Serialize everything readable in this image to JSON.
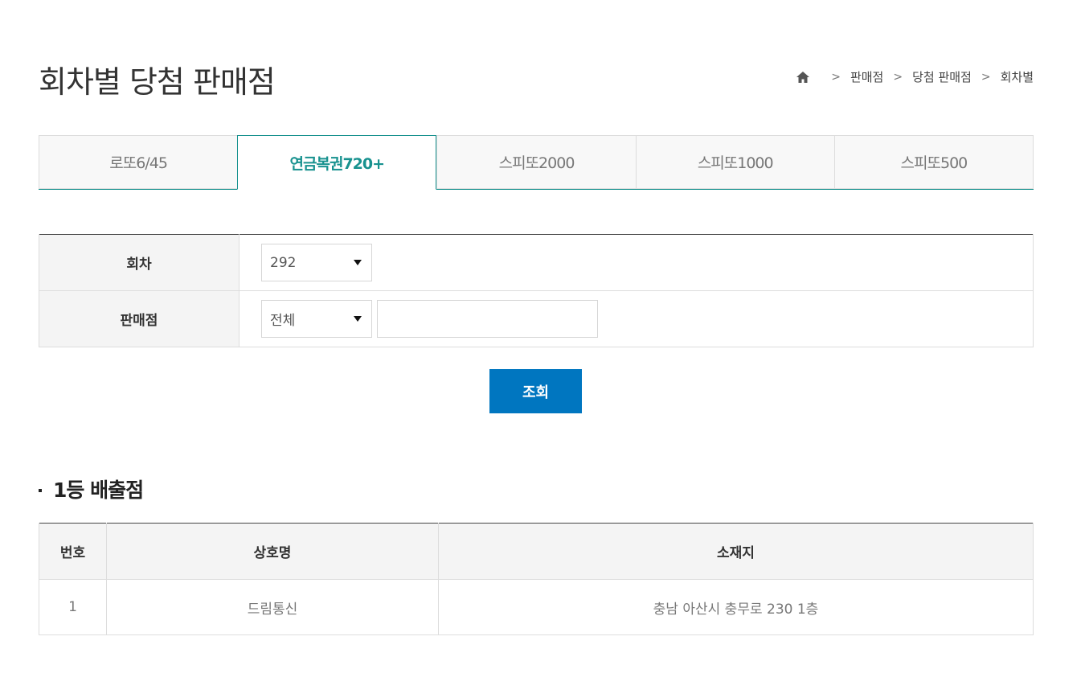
{
  "page": {
    "title": "회차별 당첨 판매점"
  },
  "breadcrumb": {
    "home_icon": "home-icon",
    "items": [
      "판매점",
      "당첨 판매점",
      "회차별"
    ]
  },
  "tabs": [
    {
      "label": "로또6/45",
      "active": false
    },
    {
      "label": "연금복권720+",
      "active": true
    },
    {
      "label": "스피또2000",
      "active": false
    },
    {
      "label": "스피또1000",
      "active": false
    },
    {
      "label": "스피또500",
      "active": false
    }
  ],
  "search": {
    "round_label": "회차",
    "round_value": "292",
    "store_label": "판매점",
    "store_filter_value": "전체",
    "store_input_value": "",
    "submit_label": "조회"
  },
  "results": {
    "section_title": "1등 배출점",
    "columns": [
      "번호",
      "상호명",
      "소재지"
    ],
    "rows": [
      {
        "no": "1",
        "name": "드림통신",
        "address": "충남 아산시 충무로 230 1층"
      }
    ]
  },
  "colors": {
    "accent_teal": "#18928f",
    "button_blue": "#0076c0"
  }
}
